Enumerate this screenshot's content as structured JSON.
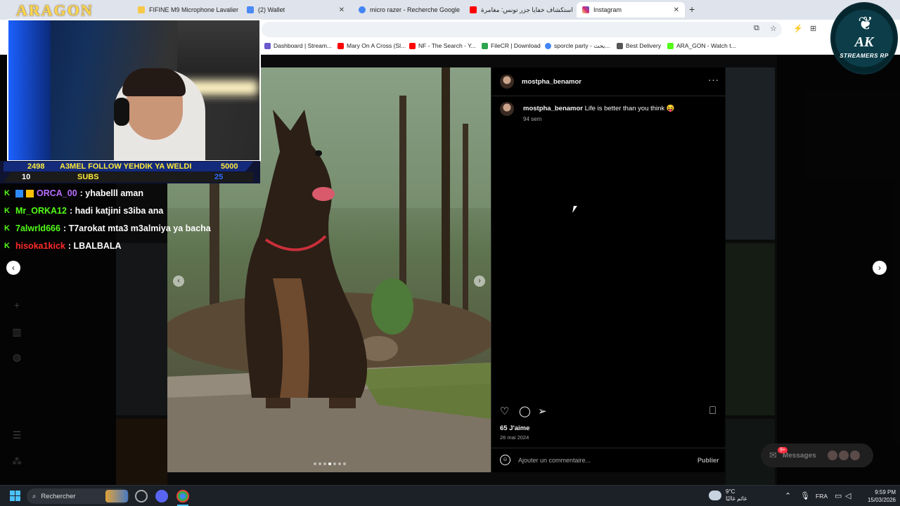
{
  "browser": {
    "tabs": [
      {
        "label": "FIFINE M9 Microphone Lavalier",
        "color": "#f7c948"
      },
      {
        "label": "(2) Wallet",
        "color": "#4a8af4"
      },
      {
        "label": "micro razer - Recherche Google",
        "color": "#4285f4"
      },
      {
        "label": "استكشاف خفايا جزر تونس: مغامرة",
        "color": "#ff0000"
      },
      {
        "label": "Instagram",
        "color": "#d6249f"
      }
    ],
    "new_tab": "+",
    "bookmarks": [
      {
        "label": "Dashboard | Stream...",
        "color": "#6a5acd",
        "icon": "SL"
      },
      {
        "label": "Mary On A Cross (Sl...",
        "color": "#ff0000"
      },
      {
        "label": "NF - The Search - Y...",
        "color": "#ff0000"
      },
      {
        "label": "FileCR | Download",
        "color": "#2da44e"
      },
      {
        "label": "sporcle party - بحث...",
        "color": "#4285f4"
      },
      {
        "label": "Best Delivery",
        "color": "#555"
      },
      {
        "label": "ARA_GON - Watch t...",
        "color": "#53fc18"
      }
    ]
  },
  "post": {
    "username": "mostpha_benamor",
    "caption_user": "mostpha_benamor",
    "caption_text": "Life is better than you think 😝",
    "caption_time": "94 sem",
    "likes": "65 J'aime",
    "date": "26 mai 2024",
    "comment_placeholder": "Ajouter un commentaire...",
    "publish_label": "Publier",
    "more": "···"
  },
  "messages": {
    "label": "Messages",
    "badge": "9+"
  },
  "stream": {
    "logo": "ARAGON",
    "goal": {
      "left": "2498",
      "title": "A3MEL FOLLOW YEHDIK YA WELDI",
      "right": "5000",
      "subs_left": "10",
      "subs_title": "SUBS",
      "subs_right": "25"
    },
    "chat": [
      {
        "user": "ORCA_00",
        "color": "#b96cff",
        "message": ": yhabelll aman"
      },
      {
        "user": "Mr_ORKA12",
        "color": "#53fc18",
        "message": ": hadi katjini s3iba ana"
      },
      {
        "user": "7alwrld666",
        "color": "#53fc18",
        "message": ": T7arokat mta3 m3almiya ya bacha"
      },
      {
        "user": "hisoka1kick",
        "color": "#ff2a2a",
        "message": ": LBALBALA"
      }
    ],
    "streamer_logo": {
      "top": "AK",
      "bottom": "STREAMERS RP"
    }
  },
  "taskbar": {
    "search": "Rechercher",
    "weather_temp": "9°C",
    "weather_text": "غائم غالبًا",
    "lang": "FRA",
    "time": "9:59 PM",
    "date": "15/03/2026"
  }
}
